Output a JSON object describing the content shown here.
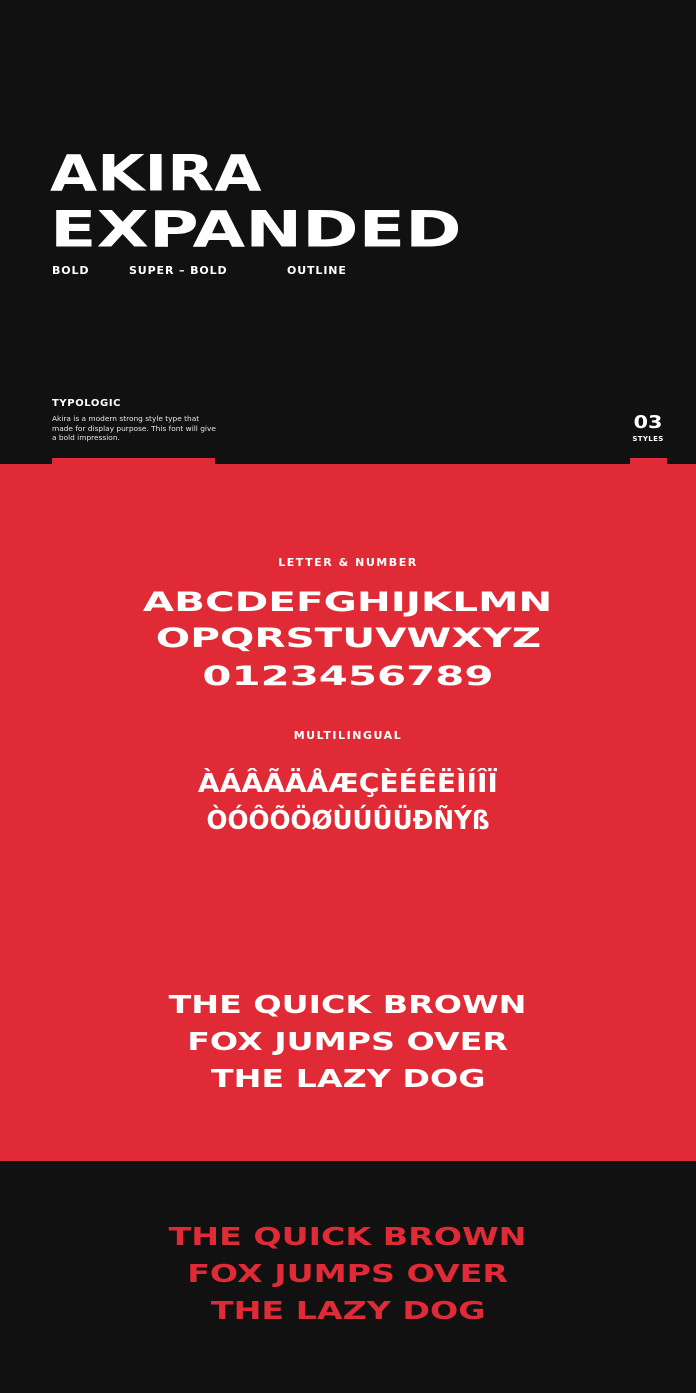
{
  "title": {
    "line1": "AKIRA",
    "line2": "EXPANDED"
  },
  "styles_list": [
    "BOLD",
    "SUPER – BOLD",
    "OUTLINE"
  ],
  "typologic": {
    "heading": "TYPOLOGIC",
    "description": "Akira is a modern strong style type that made for display purpose. This font will give a bold impression."
  },
  "styles_count": {
    "number": "03",
    "label": "STYLES"
  },
  "letters": {
    "label": "LETTER & NUMBER",
    "row1": "ABCDEFGHIJKLMN",
    "row2": "OPQRSTUVWXYZ",
    "row3": "0123456789"
  },
  "multilingual": {
    "label": "MULTILINGUAL",
    "row1": "ÀÁÂÃÄÅÆÇÈÉÊËÌÍÎÏ",
    "row2": "ÒÓÔÕÖØÙÚÛÜĐÑÝß"
  },
  "pangram": {
    "line1": "THE QUICK BROWN",
    "line2": "FOX JUMPS OVER",
    "line3": "THE LAZY DOG"
  },
  "colors": {
    "background_dark": "#111111",
    "accent_red": "#e02a36",
    "text_light": "#ffffff"
  }
}
